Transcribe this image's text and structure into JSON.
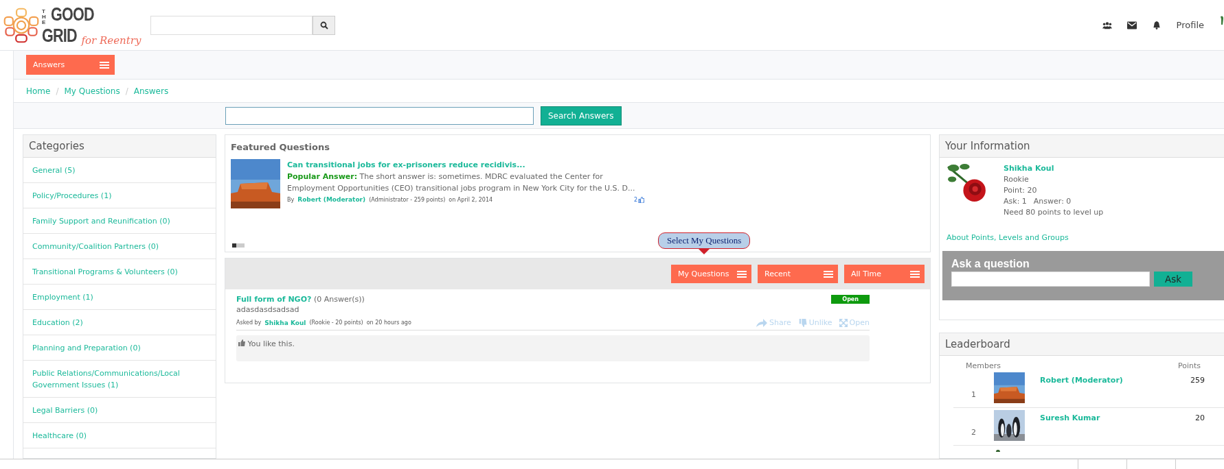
{
  "header": {
    "logo": {
      "line1": "THE",
      "line2": "GOOD",
      "line3": "GRID",
      "tagline": "for Reentry"
    },
    "profile_link": "Profile"
  },
  "section_menu": {
    "label": "Answers"
  },
  "breadcrumb": {
    "separator": "/",
    "items": [
      {
        "label": "Home"
      },
      {
        "label": "My Questions"
      },
      {
        "label": "Answers"
      }
    ]
  },
  "answer_search": {
    "button": "Search Answers"
  },
  "categories": {
    "title": "Categories",
    "items": [
      {
        "label": "General (5)"
      },
      {
        "label": "Policy/Procedures (1)"
      },
      {
        "label": "Family Support and Reunification (0)"
      },
      {
        "label": "Community/Coalition Partners (0)"
      },
      {
        "label": "Transitional Programs & Volunteers (0)"
      },
      {
        "label": "Employment (1)"
      },
      {
        "label": "Education (2)"
      },
      {
        "label": "Planning and Preparation (0)"
      },
      {
        "label": "Public Relations/Communications/Local Government Issues (1)"
      },
      {
        "label": "Legal Barriers (0)"
      },
      {
        "label": "Healthcare (0)"
      }
    ]
  },
  "featured": {
    "title": "Featured Questions",
    "question": "Can transitional jobs for ex-prisoners reduce recidivis...",
    "answer_label": "Popular Answer:",
    "answer": "The short answer is: sometimes. MDRC evaluated the Center for Employment Opportunities (CEO) transitional jobs program in New York City for the U.S. D...",
    "by": "By",
    "author": "Robert (Moderator)",
    "author_meta": "(Administrator - 259 points)",
    "date": "on April 2, 2014",
    "likes": "2",
    "pager": [
      {
        "selected": true
      },
      {
        "selected": false
      },
      {
        "selected": false
      }
    ]
  },
  "callout": "Select My Questions",
  "filters": [
    {
      "label": "My Questions"
    },
    {
      "label": "Recent"
    },
    {
      "label": "All Time"
    }
  ],
  "questions": [
    {
      "title": "Full form of NGO?",
      "answers": "(0 Answer(s))",
      "body": "adasdasdsadsad",
      "status": "Open",
      "asked_by": "Asked by",
      "author": "Shikha Koul",
      "author_meta": "(Rookie - 20 points)",
      "time": "on 20 hours ago",
      "actions": [
        {
          "kind": "share",
          "label": "Share"
        },
        {
          "kind": "unlike",
          "label": "Unlike"
        },
        {
          "kind": "open",
          "label": "Open"
        }
      ],
      "like_note": "You like this."
    }
  ],
  "your_info": {
    "title": "Your Information",
    "name": "Shikha Koul",
    "rank": "Rookie",
    "points": "Point: 20",
    "ask": "Ask: 1",
    "answer": "Answer: 0",
    "need": "Need 80 points to level up",
    "about_link": "About Points, Levels and Groups"
  },
  "ask": {
    "title": "Ask a question",
    "button": "Ask"
  },
  "leaderboard": {
    "title": "Leaderboard",
    "col_members": "Members",
    "col_points": "Points",
    "rows": [
      {
        "rank": "1",
        "name": "Robert (Moderator)",
        "points": "259",
        "kind": "mesa"
      },
      {
        "rank": "2",
        "name": "Suresh Kumar",
        "points": "20",
        "kind": "penguins"
      }
    ]
  }
}
